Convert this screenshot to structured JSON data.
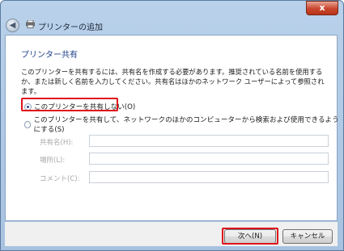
{
  "window": {
    "title": "プリンターの追加",
    "close_label": "x",
    "back_label": "◀"
  },
  "heading": "プリンター共有",
  "description": "このプリンターを共有するには、共有名を作成する必要があります。推奨されている名前を使用するか、または新しく名前を入力してください。共有名はほかのネットワーク ユーザーによって参照されます。",
  "options": [
    {
      "label": "このプリンターを共有しない(O)",
      "selected": true
    },
    {
      "label": "このプリンターを共有して、ネットワークのほかのコンピューターから検索および使用できるようにする(S)",
      "selected": false
    }
  ],
  "fields": [
    {
      "label": "共有名(H):",
      "value": ""
    },
    {
      "label": "場所(L):",
      "value": ""
    },
    {
      "label": "コメント(C):",
      "value": ""
    }
  ],
  "buttons": {
    "next": "次へ(N)",
    "cancel": "キャンセル"
  },
  "colors": {
    "highlight": "#e0141a",
    "heading": "#1e3f8a"
  }
}
